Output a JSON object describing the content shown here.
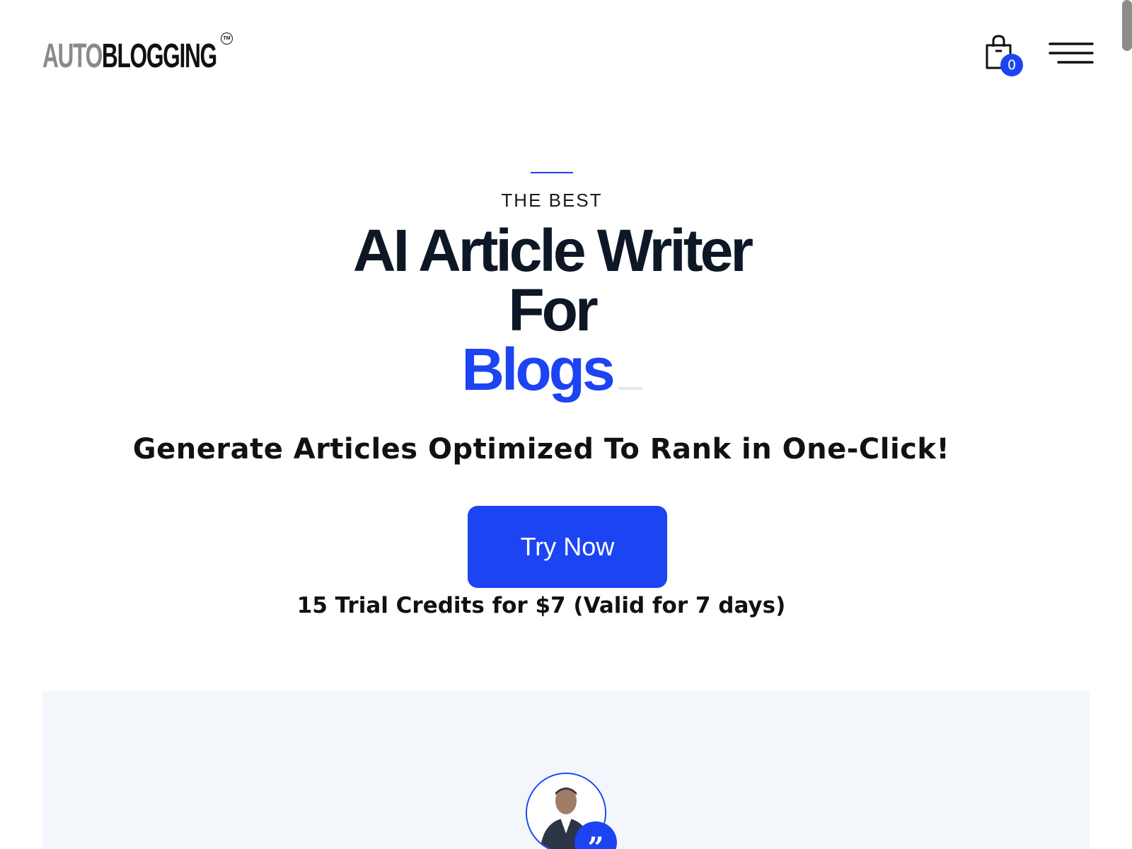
{
  "header": {
    "logo": {
      "part1": "AUTO",
      "part2": "BLOGGING",
      "tm": "TM"
    },
    "cart": {
      "count": "0",
      "icon": "shopping-bag-icon"
    },
    "menu": {
      "icon": "hamburger-menu-icon"
    }
  },
  "hero": {
    "eyebrow": "THE BEST",
    "title_line1": "AI Article Writer",
    "title_line2": "For",
    "rotating_word": "Blogs",
    "subheading": "Generate Articles Optimized To Rank in One-Click!",
    "cta_label": "Try Now",
    "trial_note": "15 Trial Credits for $7 (Valid for 7 days)"
  },
  "testimonial": {
    "quote_glyph": "”",
    "avatar_icon": "person-avatar-icon"
  },
  "colors": {
    "accent": "#1c44f2",
    "heading": "#0e1726",
    "section_bg": "#f3f6fb"
  }
}
